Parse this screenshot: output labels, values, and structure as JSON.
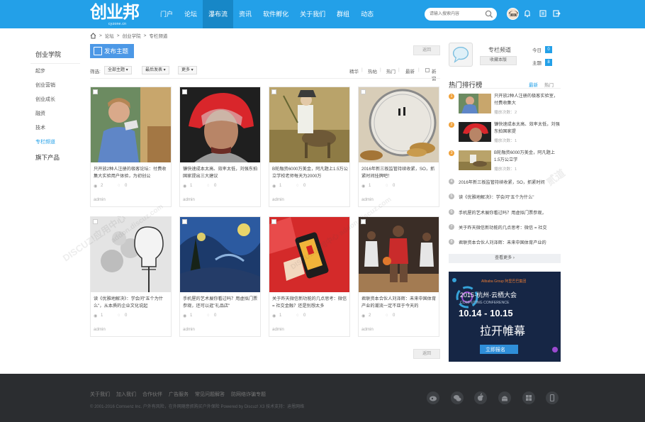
{
  "header": {
    "logo_cn": "创业邦",
    "logo_en": "cyzone.cn",
    "nav": [
      "门户",
      "论坛",
      "瀑布流",
      "资讯",
      "软件孵化",
      "关于我们",
      "群组",
      "动态"
    ],
    "search_placeholder": "请输入搜索内容"
  },
  "breadcrumb": [
    "论坛",
    "创业学院",
    "专栏频道"
  ],
  "sidebar": {
    "head": "创业学院",
    "items": [
      "起步",
      "创业营销",
      "创业成长",
      "融资",
      "技术",
      "专栏频道"
    ],
    "head2": "旗下产品"
  },
  "actions": {
    "post_label": "发布主题",
    "back_label": "返回"
  },
  "filter": {
    "label": "筛选:",
    "dd1": "全部主题",
    "dd2": "最后发表",
    "dd3": "更多",
    "sorts": [
      "精华",
      "热帖",
      "热门",
      "最新"
    ],
    "newwin": "新窗"
  },
  "cards": [
    {
      "title": "只开放2种人注册的极客论坛：付费收集大实验用户体验，为初创公",
      "views": "2",
      "replies": "0",
      "author": "admin"
    },
    {
      "title": "镰快速成本太高、效率太低，刘强东拍国家提出三大建议",
      "views": "1",
      "replies": "0",
      "author": "admin"
    },
    {
      "title": "B轮融资6000万美金，阿凡题上1.5万公立学校老师每天为2000万",
      "views": "1",
      "replies": "0",
      "author": "admin"
    },
    {
      "title": "2016年新三板监管持续收紧，SO，抓紧时间挂牌吧！",
      "views": "1",
      "replies": "0",
      "author": "admin"
    },
    {
      "title": "读《优雅地解决》：学会问\"五个为什么\"，从本质的企业文化说起",
      "views": "1",
      "replies": "0",
      "author": "admin"
    },
    {
      "title": "手机屋的艺术展你看过吗？用虚拟门票参观，还可以逛\"礼品店\"",
      "views": "1",
      "replies": "0",
      "author": "admin"
    },
    {
      "title": "关于昨天微信新功能的几点思考：微信 = 社交金融？还是别想太多",
      "views": "1",
      "replies": "0",
      "author": "admin"
    },
    {
      "title": "君联资本合伙人刘泽辉：未来中国体育产业的潮流一定不亚于今天的",
      "views": "2",
      "replies": "0",
      "author": "admin"
    }
  ],
  "forum": {
    "name": "专栏频道",
    "fav": "收藏本版",
    "today_label": "今日",
    "today": "0",
    "topics_label": "主题",
    "topics": "8"
  },
  "ranking": {
    "title": "热门排行榜",
    "tabs": [
      "最新",
      "热门"
    ],
    "view_prefix": "播放次数：",
    "top": [
      {
        "num": "1",
        "text": "只开放2种人注册的极客实验室，付费收集大",
        "views": "2"
      },
      {
        "num": "2",
        "text": "镰快速成本太高、效率太低，刘强东拍国家提",
        "views": "1"
      },
      {
        "num": "3",
        "text": "B轮融资6000万美金，阿凡题上1.5万公立学",
        "views": "1"
      }
    ],
    "rest": [
      {
        "num": "4",
        "text": "2016年新三板监管持续收紧，SO，抓紧时间"
      },
      {
        "num": "5",
        "text": "读《优雅地解决》：学会问\"五个为什么\""
      },
      {
        "num": "6",
        "text": "手机屋的艺术展你看过吗？用虚拟门票参观，"
      },
      {
        "num": "7",
        "text": "关于昨天微信新功能的几点思考：微信 = 社交"
      },
      {
        "num": "8",
        "text": "君联资本合伙人刘泽辉：未来中国体育产业的"
      }
    ],
    "more": "查看更多"
  },
  "ad": {
    "brand": "Alibaba Group 阿里巴巴集团",
    "title": "2015·杭州·云栖大会",
    "subtitle": "COMPUTING CONFERENCE",
    "date": "10.14 - 10.15",
    "slogan": "拉开帷幕",
    "cta": "立即报名"
  },
  "footer": {
    "links": [
      "关于我们",
      "加入我们",
      "合作伙伴",
      "广告服务",
      "常见问题解答",
      "防网络诈骗专题"
    ],
    "copyright": "© 2001-2016 Comsenz Inc. 户外有风险，在外网随意抓购买户外保险  Powered by  Discuz! X3  技术支持：迪恩网络"
  },
  "watermarks": [
    "DISCUZ!应用中心",
    "addon.discuz.com",
    "DISCUZ!应用中心 addon.discuz.com",
    "贰道"
  ],
  "colors": {
    "brand": "#23a0e8",
    "nav_active": "#1787c7",
    "post_button": "#4c98e6",
    "rank_top": "#f0a13a",
    "footer": "#2b2d30",
    "ad_bg": "#162645"
  }
}
